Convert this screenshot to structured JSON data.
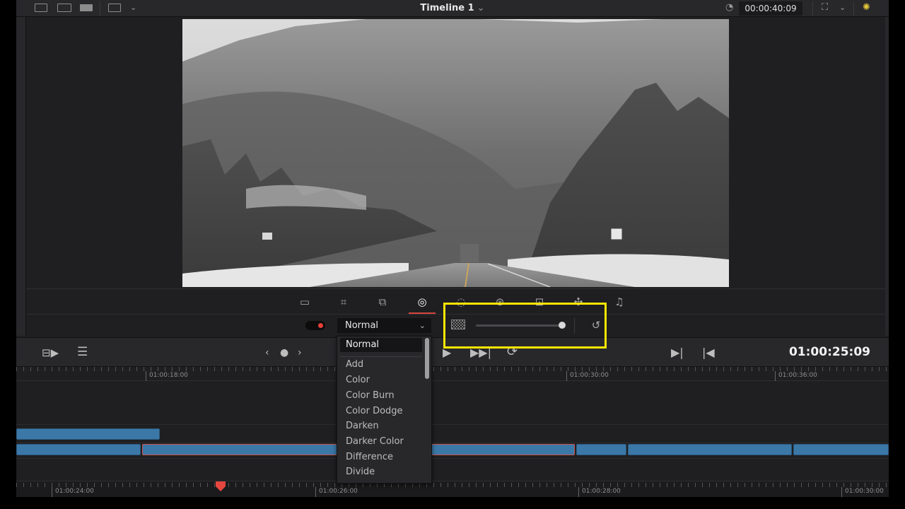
{
  "window": {
    "title": "Timeline 1",
    "timecode_top": "00:00:40:09"
  },
  "viewer": {
    "image_description_icon": "snowy-mountain-road-frame"
  },
  "inspector_tools": [
    {
      "name": "transform-tool-icon",
      "glyph": "▭"
    },
    {
      "name": "crop-tool-icon",
      "glyph": "⌗"
    },
    {
      "name": "dynamic-zoom-tool-icon",
      "glyph": "⧉"
    },
    {
      "name": "composite-tool-icon",
      "glyph": "◎"
    },
    {
      "name": "speed-tool-icon",
      "glyph": "◌"
    },
    {
      "name": "stabilization-tool-icon",
      "glyph": "⊛"
    },
    {
      "name": "lens-correction-tool-icon",
      "glyph": "⊡"
    },
    {
      "name": "fx-tool-icon",
      "glyph": "✣"
    },
    {
      "name": "audio-tool-icon",
      "glyph": "♫"
    }
  ],
  "composite": {
    "blend_mode": "Normal",
    "opacity_fraction": 1.0
  },
  "blend_menu": {
    "selected": "Normal",
    "items": [
      "Add",
      "Color",
      "Color Burn",
      "Color Dodge",
      "Darken",
      "Darker Color",
      "Difference",
      "Divide"
    ]
  },
  "transport": {
    "timecode": "01:00:25:09"
  },
  "ruler_upper": [
    "01:00:18:00",
    "01:00:30:00",
    "01:00:36:00"
  ],
  "ruler_lower": [
    "01:00:24:00",
    "01:00:26:00",
    "01:00:28:00",
    "01:00:30:00"
  ],
  "colors": {
    "accent_red": "#d8453e",
    "clip_blue": "#3b78a8",
    "highlight_yellow": "#ffe600"
  }
}
